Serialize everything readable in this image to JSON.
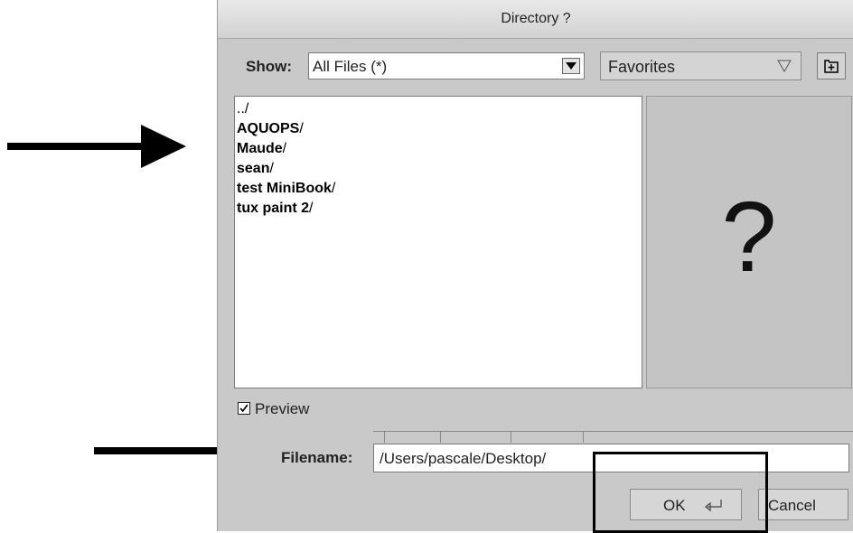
{
  "dialog": {
    "title": "Directory ?",
    "show_label": "Show:",
    "show_value": "All Files (*)",
    "favorites_value": "Favorites",
    "new_folder_icon": "new-folder-icon",
    "files": [
      {
        "name": "..",
        "suffix": "/"
      },
      {
        "name": "AQUOPS",
        "suffix": "/"
      },
      {
        "name": "Maude",
        "suffix": "/"
      },
      {
        "name": "sean",
        "suffix": "/"
      },
      {
        "name": "test MiniBook",
        "suffix": "/"
      },
      {
        "name": "tux paint 2",
        "suffix": "/"
      }
    ],
    "preview_glyph": "?",
    "preview_label": "Preview",
    "preview_checked": true,
    "filename_label": "Filename:",
    "filename_value": "/Users/pascale/Desktop/",
    "ok_label": "OK",
    "cancel_label": "Cancel"
  },
  "annotations": {
    "arrow_color": "#000000",
    "highlight_color": "#000000"
  }
}
